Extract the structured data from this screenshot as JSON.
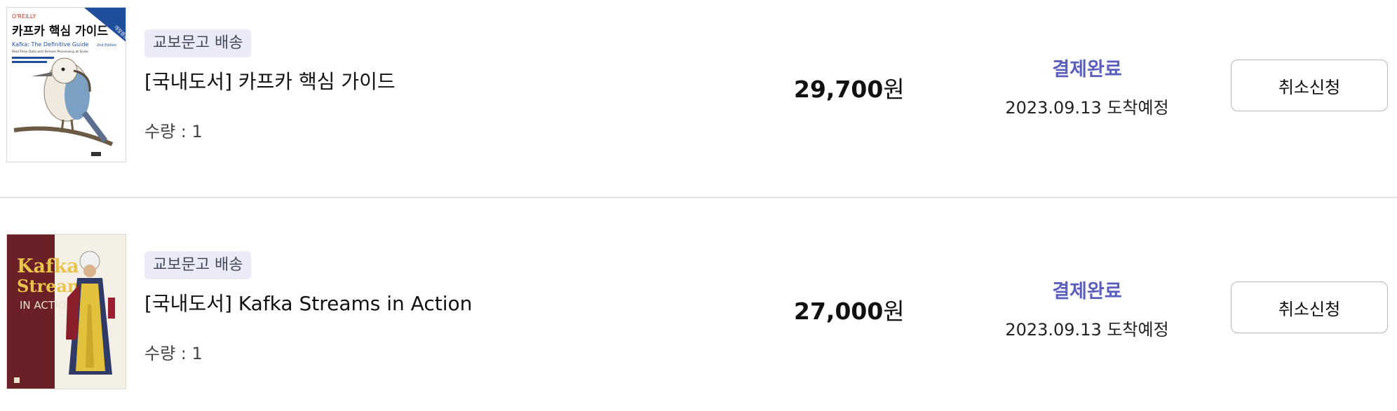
{
  "orders": [
    {
      "cover": {
        "publisher": "O'REILLY",
        "title_ko": "카프카 핵심 가이드",
        "title_en": "Kafka: The Definitive Guide",
        "edition": "2nd Edition",
        "subtitle": "Real-Time Data and Stream Processing at Scale",
        "ribbon": "개정증보판",
        "bg": "#ffffff",
        "accent": "#1f4e9c"
      },
      "tag": "교보문고 배송",
      "title": "[국내도서] 카프카 핵심 가이드",
      "qty": "수량 : 1",
      "price": "29,700",
      "currency": "원",
      "status": "결제완료",
      "arrival": "2023.09.13 도착예정",
      "button": "취소신청"
    },
    {
      "cover": {
        "title_line1": "Kafka",
        "title_line2": "Streams",
        "title_line3": "IN ACTION",
        "bg": "#6b1f26",
        "title_color": "#e8c44c"
      },
      "tag": "교보문고 배송",
      "title": "[국내도서] Kafka Streams in Action",
      "qty": "수량 : 1",
      "price": "27,000",
      "currency": "원",
      "status": "결제완료",
      "arrival": "2023.09.13 도착예정",
      "button": "취소신청"
    }
  ]
}
